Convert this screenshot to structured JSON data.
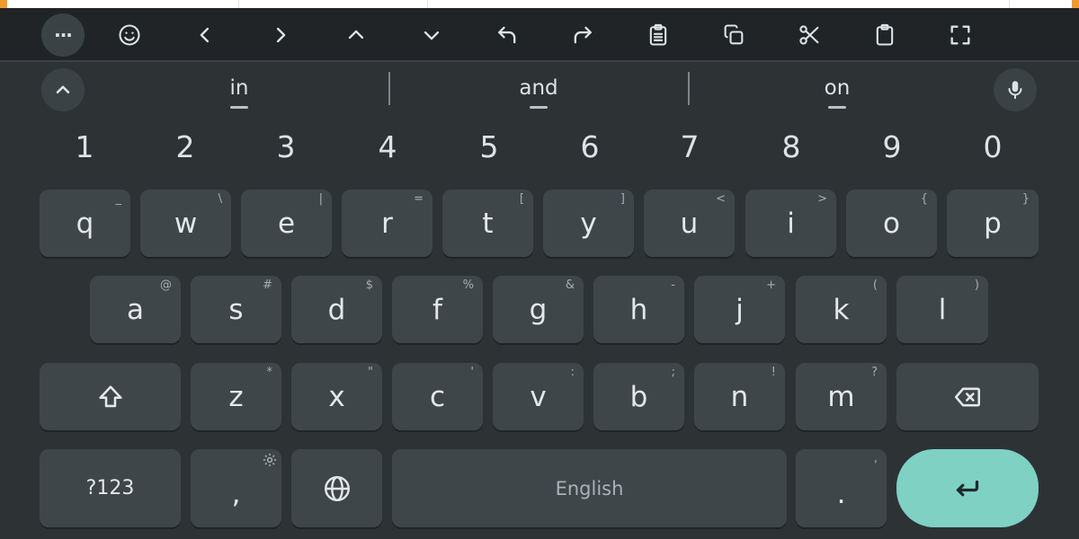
{
  "colors": {
    "background": "#2d3335",
    "toolbar": "#202426",
    "key": "#3f4649",
    "enter": "#7fd1c4",
    "text": "#dce3e6",
    "hint": "#a5aeb2"
  },
  "toolbar": {
    "icons": [
      "more-icon",
      "emoji-icon",
      "left-arrow-icon",
      "right-arrow-icon",
      "up-arrow-icon",
      "down-arrow-icon",
      "undo-icon",
      "redo-icon",
      "clipboard-icon",
      "copy-icon",
      "cut-icon",
      "paste-icon",
      "fullscreen-icon"
    ],
    "more_label": "···"
  },
  "suggestions": {
    "words": [
      "in",
      "and",
      "on"
    ],
    "collapse_icon": "chevron-up-icon",
    "mic_icon": "microphone-icon"
  },
  "number_row": [
    "1",
    "2",
    "3",
    "4",
    "5",
    "6",
    "7",
    "8",
    "9",
    "0"
  ],
  "rows": {
    "row1": [
      {
        "key": "q",
        "hint": "_"
      },
      {
        "key": "w",
        "hint": "\\"
      },
      {
        "key": "e",
        "hint": "|"
      },
      {
        "key": "r",
        "hint": "="
      },
      {
        "key": "t",
        "hint": "["
      },
      {
        "key": "y",
        "hint": "]"
      },
      {
        "key": "u",
        "hint": "<"
      },
      {
        "key": "i",
        "hint": ">"
      },
      {
        "key": "o",
        "hint": "{"
      },
      {
        "key": "p",
        "hint": "}"
      }
    ],
    "row2": [
      {
        "key": "a",
        "hint": "@"
      },
      {
        "key": "s",
        "hint": "#"
      },
      {
        "key": "d",
        "hint": "$"
      },
      {
        "key": "f",
        "hint": "%"
      },
      {
        "key": "g",
        "hint": "&"
      },
      {
        "key": "h",
        "hint": "-"
      },
      {
        "key": "j",
        "hint": "+"
      },
      {
        "key": "k",
        "hint": "("
      },
      {
        "key": "l",
        "hint": ")"
      }
    ],
    "row3": [
      {
        "key": "z",
        "hint": "*"
      },
      {
        "key": "x",
        "hint": "\""
      },
      {
        "key": "c",
        "hint": "'"
      },
      {
        "key": "v",
        "hint": ":"
      },
      {
        "key": "b",
        "hint": ";"
      },
      {
        "key": "n",
        "hint": "!"
      },
      {
        "key": "m",
        "hint": "?"
      }
    ]
  },
  "bottom_row": {
    "symbols_label": "?123",
    "comma_label": ",",
    "space_label": "English",
    "period_label": ".",
    "period_hint": ","
  }
}
